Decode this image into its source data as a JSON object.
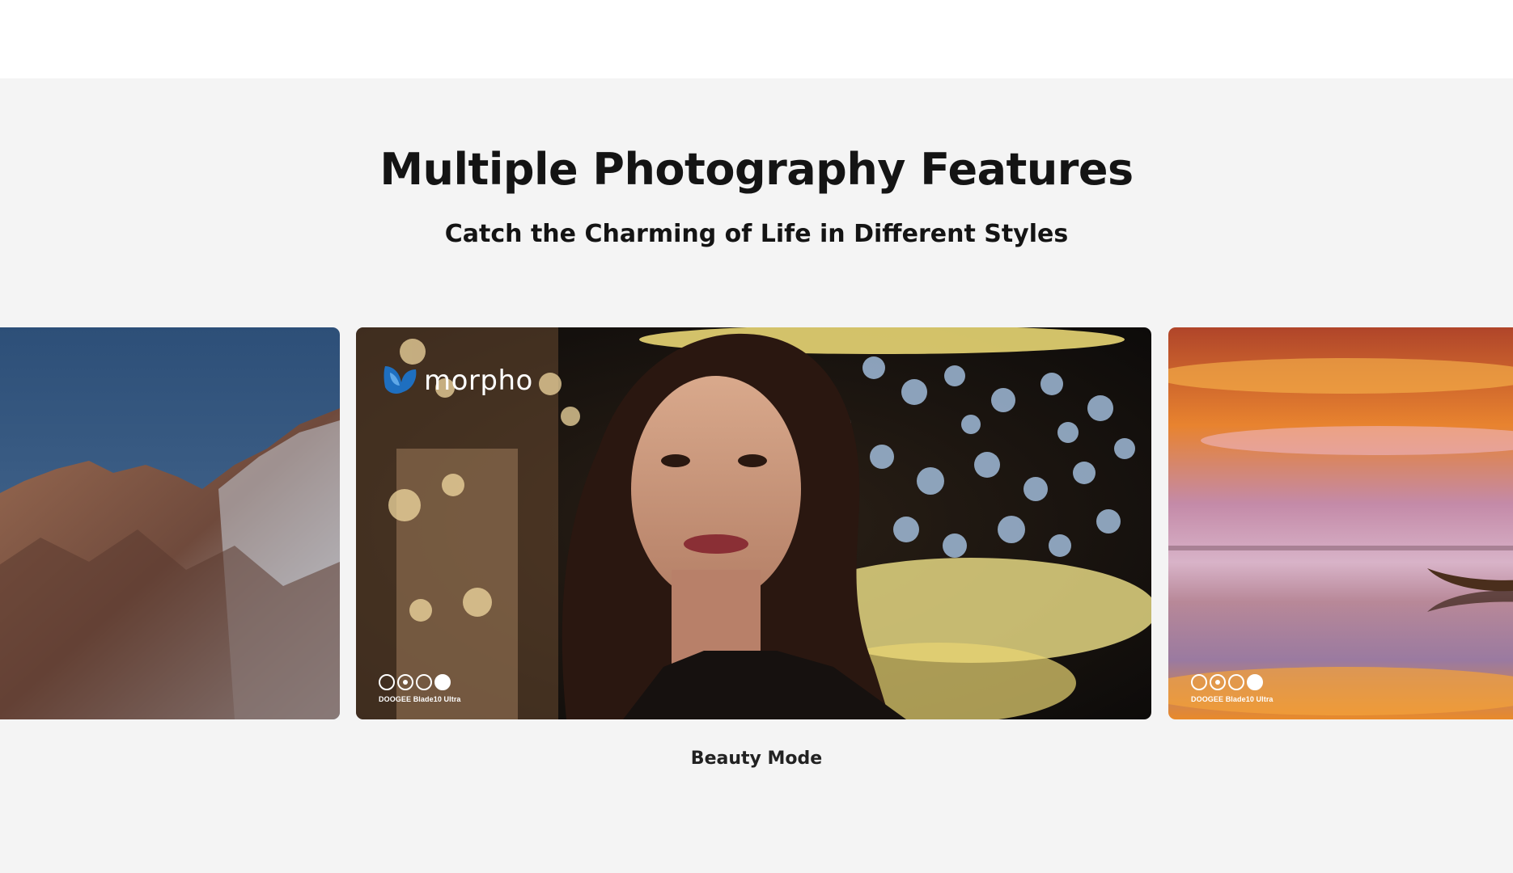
{
  "section": {
    "title": "Multiple Photography Features",
    "subtitle": "Catch the Charming of Life in Different Styles"
  },
  "carousel": {
    "slides": [
      {
        "name": "mountain",
        "watermark": ""
      },
      {
        "name": "beauty",
        "logo_text": "morpho",
        "watermark": "DOOGEE Blade10 Ultra"
      },
      {
        "name": "sunset-lake",
        "watermark": "DOOGEE Blade10 Ultra"
      }
    ],
    "active_caption": "Beauty Mode"
  },
  "colors": {
    "section_bg": "#f4f4f4",
    "text": "#141414",
    "logo_blue": "#1e6fc0"
  },
  "icons": [
    "morpho-logo-icon",
    "camera-rings-icon"
  ]
}
